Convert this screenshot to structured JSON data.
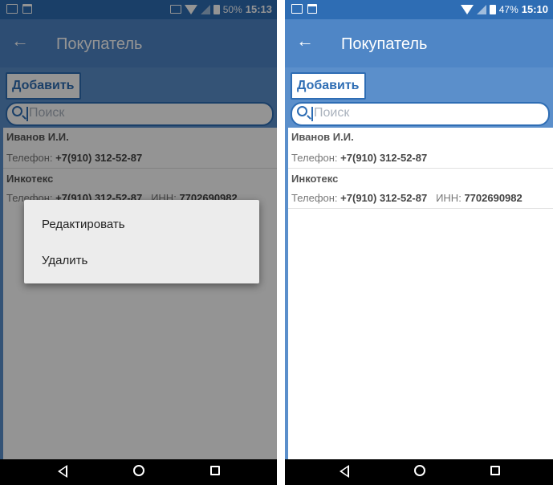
{
  "left_screen": {
    "status_bar": {
      "battery": "50%",
      "time": "15:13"
    },
    "app_bar": {
      "title": "Покупатель"
    },
    "add_button": "Добавить",
    "search": {
      "placeholder": "Поиск"
    },
    "customers": [
      {
        "name": "Иванов И.И.",
        "phone_label": "Телефон:",
        "phone": "+7(910) 312-52-87"
      },
      {
        "name": "Инкотекс",
        "phone_label": "Телефон:",
        "phone": "+7(910) 312-52-87",
        "inn_label": "ИНН:",
        "inn": "7702690982"
      }
    ],
    "context_menu": {
      "items": [
        "Редактировать",
        "Удалить"
      ]
    }
  },
  "right_screen": {
    "status_bar": {
      "battery": "47%",
      "time": "15:10"
    },
    "app_bar": {
      "title": "Покупатель"
    },
    "add_button": "Добавить",
    "search": {
      "placeholder": "Поиск"
    },
    "customers": [
      {
        "name": "Иванов И.И.",
        "phone_label": "Телефон:",
        "phone": "+7(910) 312-52-87"
      },
      {
        "name": "Инкотекс",
        "phone_label": "Телефон:",
        "phone": "+7(910) 312-52-87",
        "inn_label": "ИНН:",
        "inn": "7702690982"
      }
    ]
  },
  "colors": {
    "primary": "#2e6db4",
    "app_bar": "#4f86c6",
    "background": "#5b8fcb",
    "dim_overlay": "rgba(0,0,0,0.42)"
  }
}
